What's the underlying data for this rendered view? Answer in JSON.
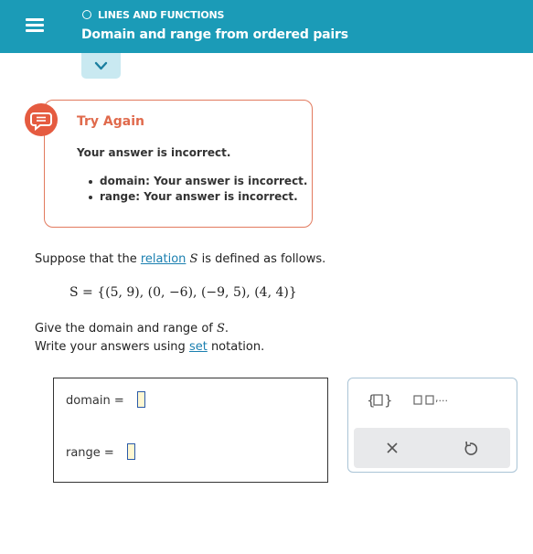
{
  "header": {
    "topic": "LINES AND FUNCTIONS",
    "title": "Domain and range from ordered pairs",
    "color": "#1b9bb7"
  },
  "feedback": {
    "heading": "Try Again",
    "message": "Your answer is incorrect.",
    "items": [
      "domain: Your answer is incorrect.",
      "range: Your answer is incorrect."
    ],
    "color": "#e55b40"
  },
  "question": {
    "line1_before": "Suppose that the ",
    "line1_link": "relation",
    "line1_var": "S",
    "line1_after": " is defined as follows.",
    "set_equation": "S = {(5, 9), (0, −6), (−9, 5), (4, 4)}",
    "line2_before": "Give the domain and range of ",
    "line2_var": "S",
    "line2_after": ".",
    "line3_before": "Write your answers using ",
    "line3_link": "set",
    "line3_after": " notation."
  },
  "answer": {
    "domain_label": "domain  =",
    "range_label": "range  ="
  },
  "toolbar": {
    "icons": [
      "set-braces-icon",
      "list-boxes-icon",
      "clear-x-icon",
      "undo-icon"
    ],
    "list_ellipsis": ",..."
  }
}
